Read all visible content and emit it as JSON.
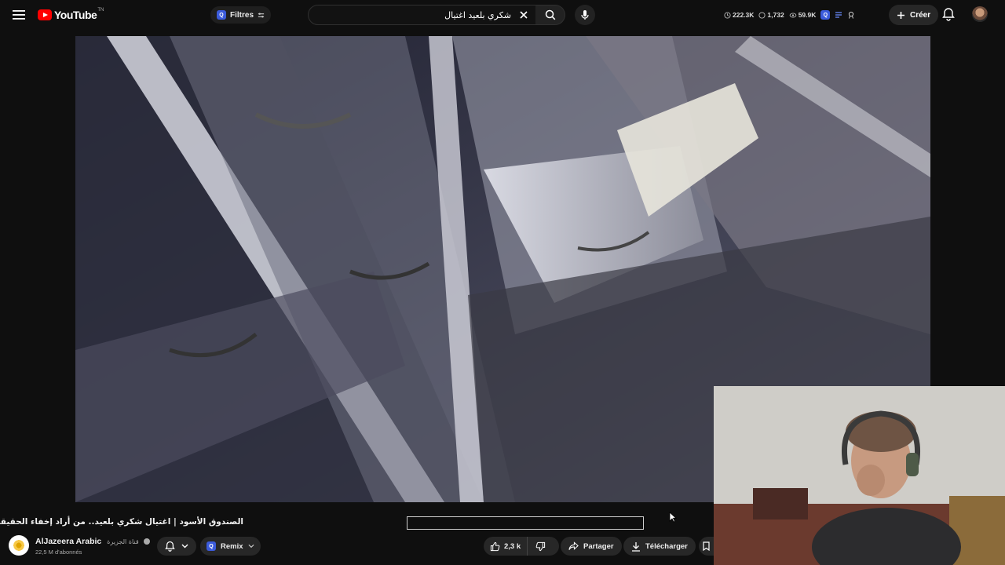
{
  "header": {
    "logo_text": "YouTube",
    "logo_sup": "TN",
    "filters_label": "Filtres",
    "search_value": "شكري بلعيد اغتيال",
    "stats": [
      {
        "icon": "clock-icon",
        "value": "222.3K"
      },
      {
        "icon": "chat-icon",
        "value": "1,732"
      },
      {
        "icon": "eye-icon",
        "value": "59.9K"
      }
    ],
    "create_label": "Créer"
  },
  "video": {
    "title": "الصندوق الأسود | اغتيال شكري بلعيد.. من أراد إخفاء الحقيقة؟",
    "progress_fraction": 0.0
  },
  "channel": {
    "name": "AlJazeera Arabic",
    "arabic_name": "قناة الجزيرة",
    "subscribers": "22,5 M d'abonnés"
  },
  "actions": {
    "remix_label": "Remix",
    "like_count": "2,3 k",
    "share_label": "Partager",
    "download_label": "Télécharger"
  },
  "colors": {
    "background": "#0f0f0f",
    "brand_red": "#ff0000",
    "chip": "#272727"
  }
}
